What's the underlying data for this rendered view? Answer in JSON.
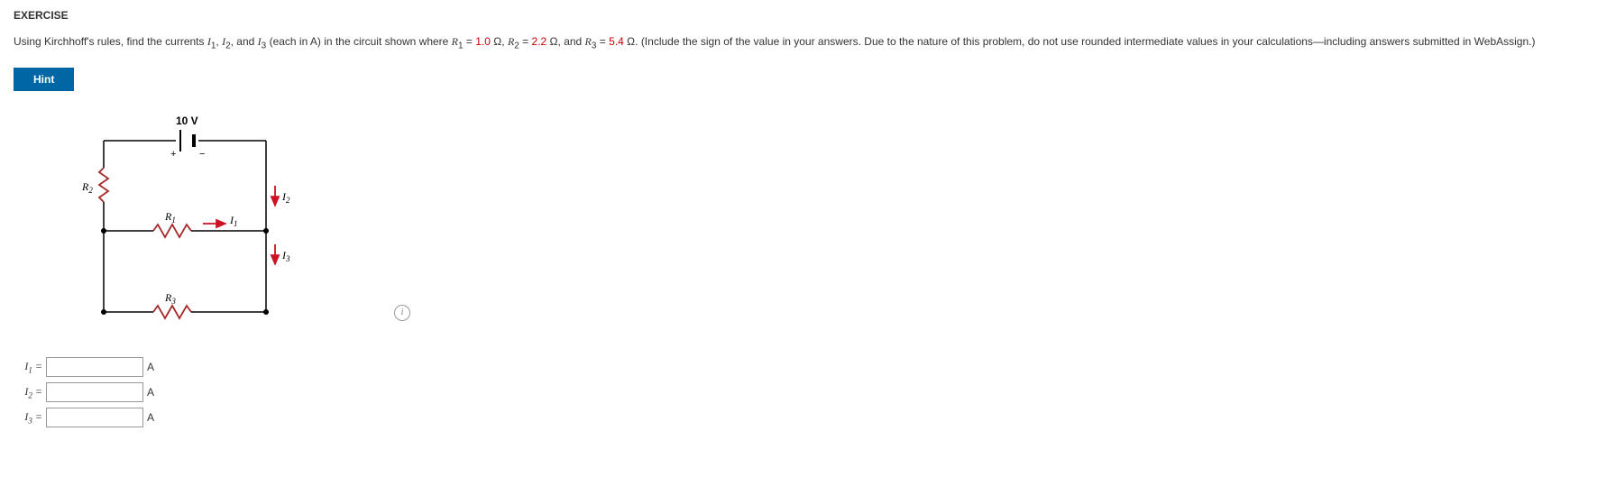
{
  "heading": "EXERCISE",
  "problem": {
    "pre": "Using Kirchhoff's rules, find the currents ",
    "i1": "I",
    "i1sub": "1",
    "c1": ", ",
    "i2": "I",
    "i2sub": "2",
    "c2": ", and ",
    "i3": "I",
    "i3sub": "3",
    "mid": " (each in A) in the circuit shown where ",
    "r1": "R",
    "r1sub": "1",
    "eq1": " = ",
    "r1val": "1.0",
    "r1unit": " Ω, ",
    "r2": "R",
    "r2sub": "2",
    "eq2": " = ",
    "r2val": "2.2",
    "r2unit": " Ω, and ",
    "r3": "R",
    "r3sub": "3",
    "eq3": " = ",
    "r3val": "5.4",
    "r3unit": " Ω. ",
    "post": "(Include the sign of the value in your answers. Due to the nature of this problem, do not use rounded intermediate values in your calculations—including answers submitted in WebAssign.)"
  },
  "hint_label": "Hint",
  "circuit": {
    "voltage": "10 V",
    "R1": "R",
    "R1sub": "1",
    "R2": "R",
    "R2sub": "2",
    "R3": "R",
    "R3sub": "3",
    "I1": "I",
    "I1sub": "1",
    "I2": "I",
    "I2sub": "2",
    "I3": "I",
    "I3sub": "3",
    "chart_data": {
      "type": "circuit",
      "voltage_source_V": 10,
      "resistors_ohm": {
        "R1": 1.0,
        "R2": 2.2,
        "R3": 5.4
      },
      "unknown_currents": [
        "I1",
        "I2",
        "I3"
      ]
    }
  },
  "answers": {
    "row1": {
      "sym": "I",
      "sub": "1",
      "eq": " = ",
      "unit": "A"
    },
    "row2": {
      "sym": "I",
      "sub": "2",
      "eq": " = ",
      "unit": "A"
    },
    "row3": {
      "sym": "I",
      "sub": "3",
      "eq": " = ",
      "unit": "A"
    }
  },
  "info_icon": "i"
}
